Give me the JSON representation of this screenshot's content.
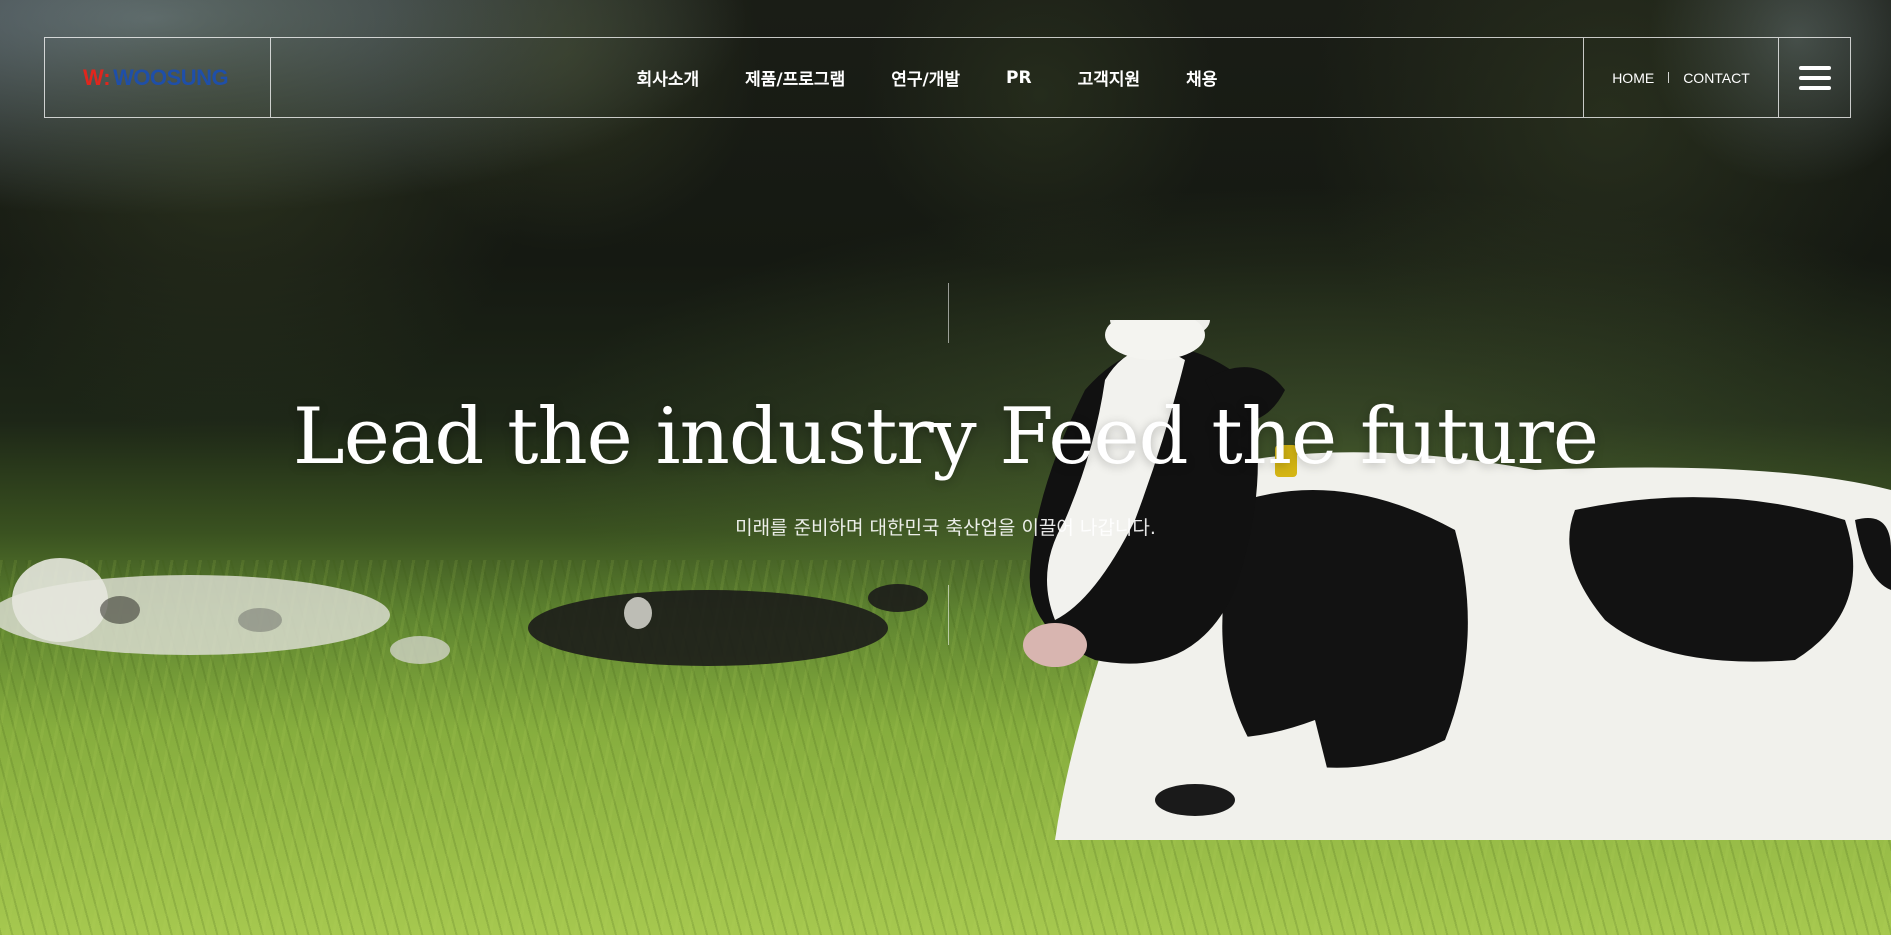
{
  "header": {
    "logo": {
      "mark": "W",
      "colon": ":",
      "name": "WOOSUNG"
    },
    "nav": [
      {
        "label": "회사소개"
      },
      {
        "label": "제품/프로그램"
      },
      {
        "label": "연구/개발"
      },
      {
        "label": "PR"
      },
      {
        "label": "고객지원"
      },
      {
        "label": "채용"
      }
    ],
    "util": {
      "home": "HOME",
      "contact": "CONTACT"
    },
    "menu_icon": "hamburger-menu-icon"
  },
  "hero": {
    "headline": "Lead the industry Feed the future",
    "subline": "미래를 준비하며 대한민국 축산업을 이끌어 나갑니다."
  },
  "colors": {
    "logo_red": "#e0261d",
    "logo_blue": "#1f4fa8",
    "text": "#ffffff"
  }
}
